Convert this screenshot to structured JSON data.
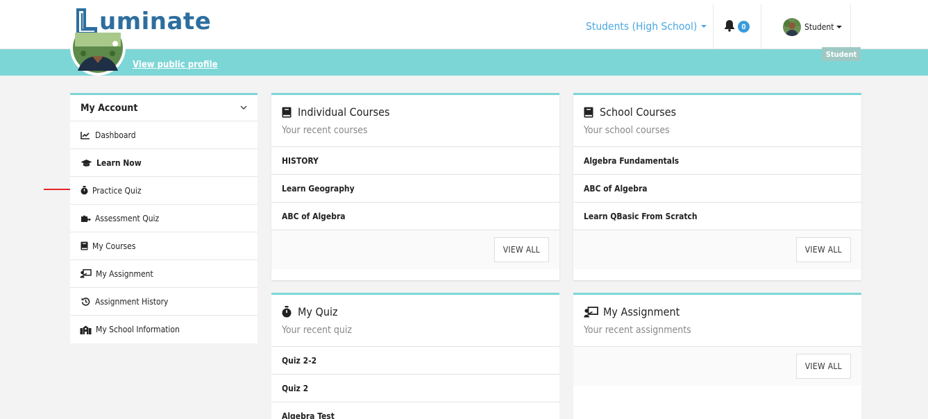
{
  "brand": {
    "name": "uminate"
  },
  "navbar": {
    "school_selector": "Students (High School)",
    "notification_count": "0",
    "user_label": "Student"
  },
  "banner": {
    "view_profile": "View public profile",
    "role": "Student"
  },
  "sidebar": {
    "title": "My Account",
    "items": [
      {
        "label": "Dashboard",
        "icon": "chart-line-icon"
      },
      {
        "label": "Learn Now",
        "icon": "graduation-cap-icon"
      },
      {
        "label": "Practice Quiz",
        "icon": "stopwatch-icon"
      },
      {
        "label": "Assessment Quiz",
        "icon": "puzzle-icon"
      },
      {
        "label": "My Courses",
        "icon": "book-icon"
      },
      {
        "label": "My Assignment",
        "icon": "chalkboard-teacher-icon"
      },
      {
        "label": "Assignment History",
        "icon": "history-icon"
      },
      {
        "label": "My School Information",
        "icon": "school-icon"
      }
    ]
  },
  "cards": {
    "individual": {
      "title": "Individual Courses",
      "subtitle": "Your recent courses",
      "rows": [
        "HISTORY",
        "Learn Geography",
        "ABC of Algebra"
      ],
      "button": "VIEW ALL"
    },
    "school": {
      "title": "School Courses",
      "subtitle": "Your school courses",
      "rows": [
        "Algebra Fundamentals",
        "ABC of Algebra",
        "Learn QBasic From Scratch"
      ],
      "button": "VIEW ALL"
    },
    "quiz": {
      "title": "My Quiz",
      "subtitle": "Your recent quiz",
      "rows": [
        "Quiz 2-2",
        "Quiz 2",
        "Algebra Test"
      ]
    },
    "assignment": {
      "title": "My Assignment",
      "subtitle": "Your recent assignments",
      "button": "VIEW ALL"
    }
  },
  "colors": {
    "accent": "#7dd6d6",
    "brand": "#2d6e9e",
    "link": "#4aa8e0",
    "badge": "#3a9bdc",
    "annotation_arrow": "#e8242a"
  }
}
